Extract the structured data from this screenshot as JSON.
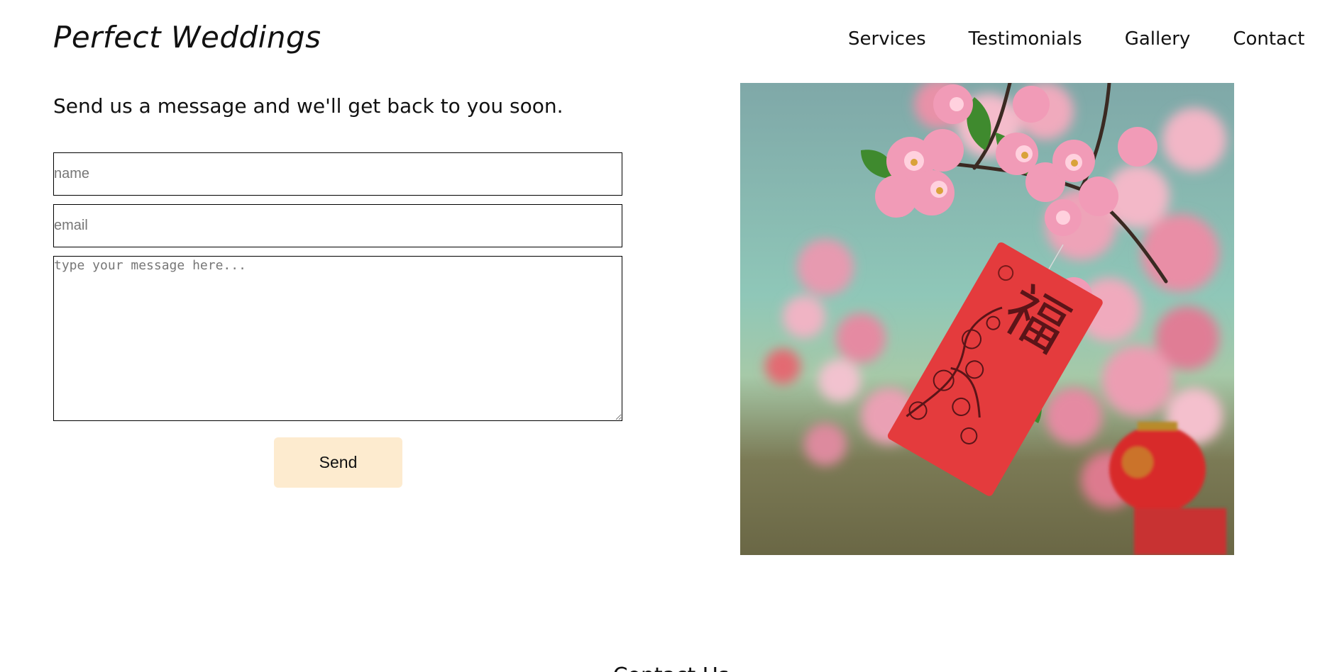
{
  "header": {
    "brand": "Perfect Weddings",
    "nav": [
      {
        "label": "Services"
      },
      {
        "label": "Testimonials"
      },
      {
        "label": "Gallery"
      },
      {
        "label": "Contact"
      }
    ]
  },
  "contact_form": {
    "intro": "Send us a message and we'll get back to you soon.",
    "name_placeholder": "name",
    "email_placeholder": "email",
    "message_placeholder": "type your message here...",
    "send_label": "Send"
  },
  "photo": {
    "description": "pink blossom branch with red envelope"
  },
  "footer": {
    "heading": "Contact Us"
  },
  "colors": {
    "send_button_bg": "#fdebcf",
    "text": "#111111",
    "placeholder": "#777777"
  }
}
